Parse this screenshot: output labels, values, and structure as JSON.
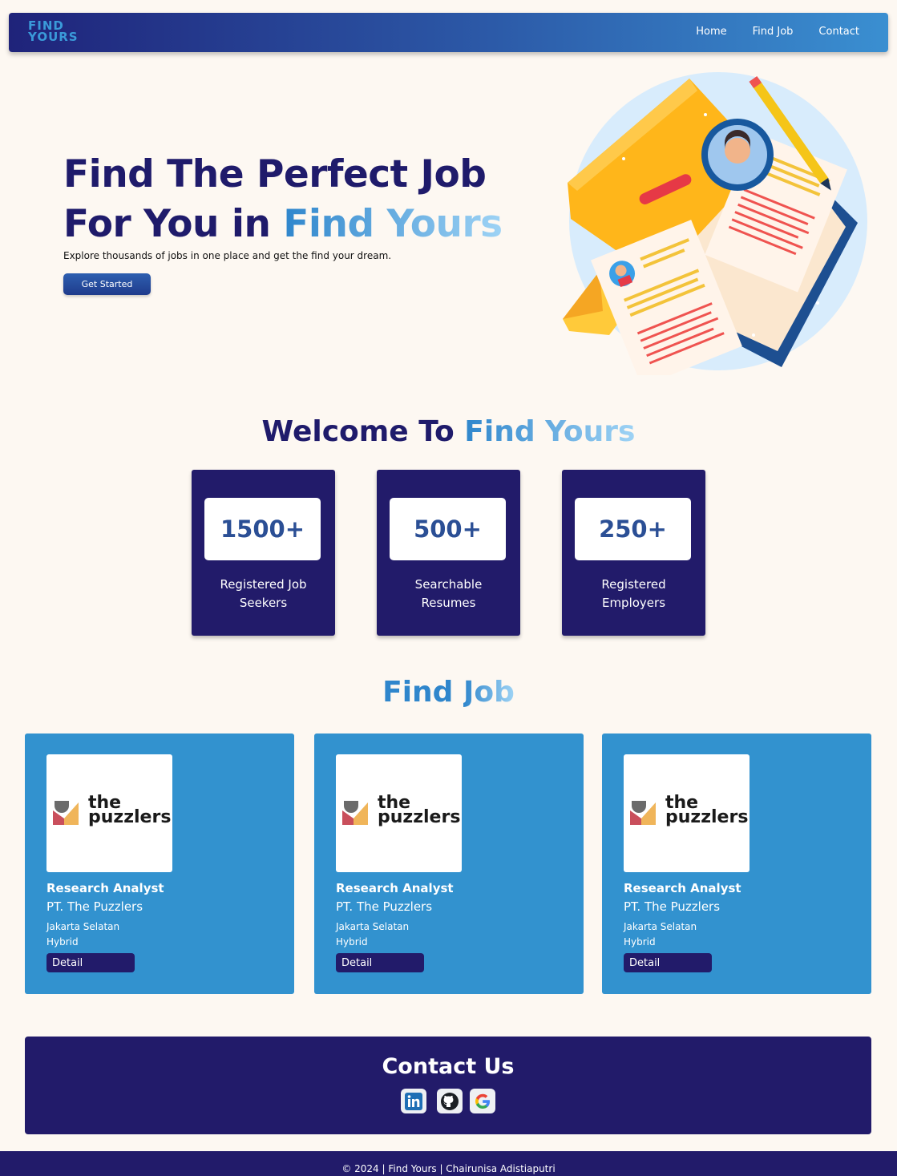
{
  "brand": {
    "logo_line1": "FIND",
    "logo_line2": "YOURS"
  },
  "nav": {
    "items": [
      "Home",
      "Find Job",
      "Contact"
    ]
  },
  "hero": {
    "title_line1": "Find The Perfect Job",
    "title_line2_prefix": "For You in ",
    "title_line2_accent": "Find Yours",
    "subtitle": "Explore thousands of jobs in one place and get the find your dream.",
    "cta": "Get Started"
  },
  "welcome": {
    "prefix": "Welcome To ",
    "accent": "Find Yours",
    "stats": [
      {
        "value": "1500+",
        "label_line1": "Registered Job",
        "label_line2": "Seekers"
      },
      {
        "value": "500+",
        "label_line1": "Searchable",
        "label_line2": "Resumes"
      },
      {
        "value": "250+",
        "label_line1": "Registered",
        "label_line2": "Employers"
      }
    ]
  },
  "find_job": {
    "title_part1": "Find ",
    "title_part2": "Job",
    "jobs": [
      {
        "logo_word1": "the",
        "logo_word2": "puzzlers",
        "title": "Research Analyst",
        "company": "PT. The Puzzlers",
        "location": "Jakarta Selatan",
        "type": "Hybrid",
        "button": "Detail"
      },
      {
        "logo_word1": "the",
        "logo_word2": "puzzlers",
        "title": "Research Analyst",
        "company": "PT. The Puzzlers",
        "location": "Jakarta Selatan",
        "type": "Hybrid",
        "button": "Detail"
      },
      {
        "logo_word1": "the",
        "logo_word2": "puzzlers",
        "title": "Research Analyst",
        "company": "PT. The Puzzlers",
        "location": "Jakarta Selatan",
        "type": "Hybrid",
        "button": "Detail"
      }
    ]
  },
  "contact": {
    "title": "Contact Us",
    "icons": [
      "linkedin-icon",
      "github-icon",
      "google-icon"
    ]
  },
  "footer": {
    "text": "© 2024 | Find Yours | Chairunisa Adistiaputri"
  },
  "colors": {
    "navy": "#221b6a",
    "accent_blue": "#3292cf",
    "background": "#fdf8f2"
  }
}
